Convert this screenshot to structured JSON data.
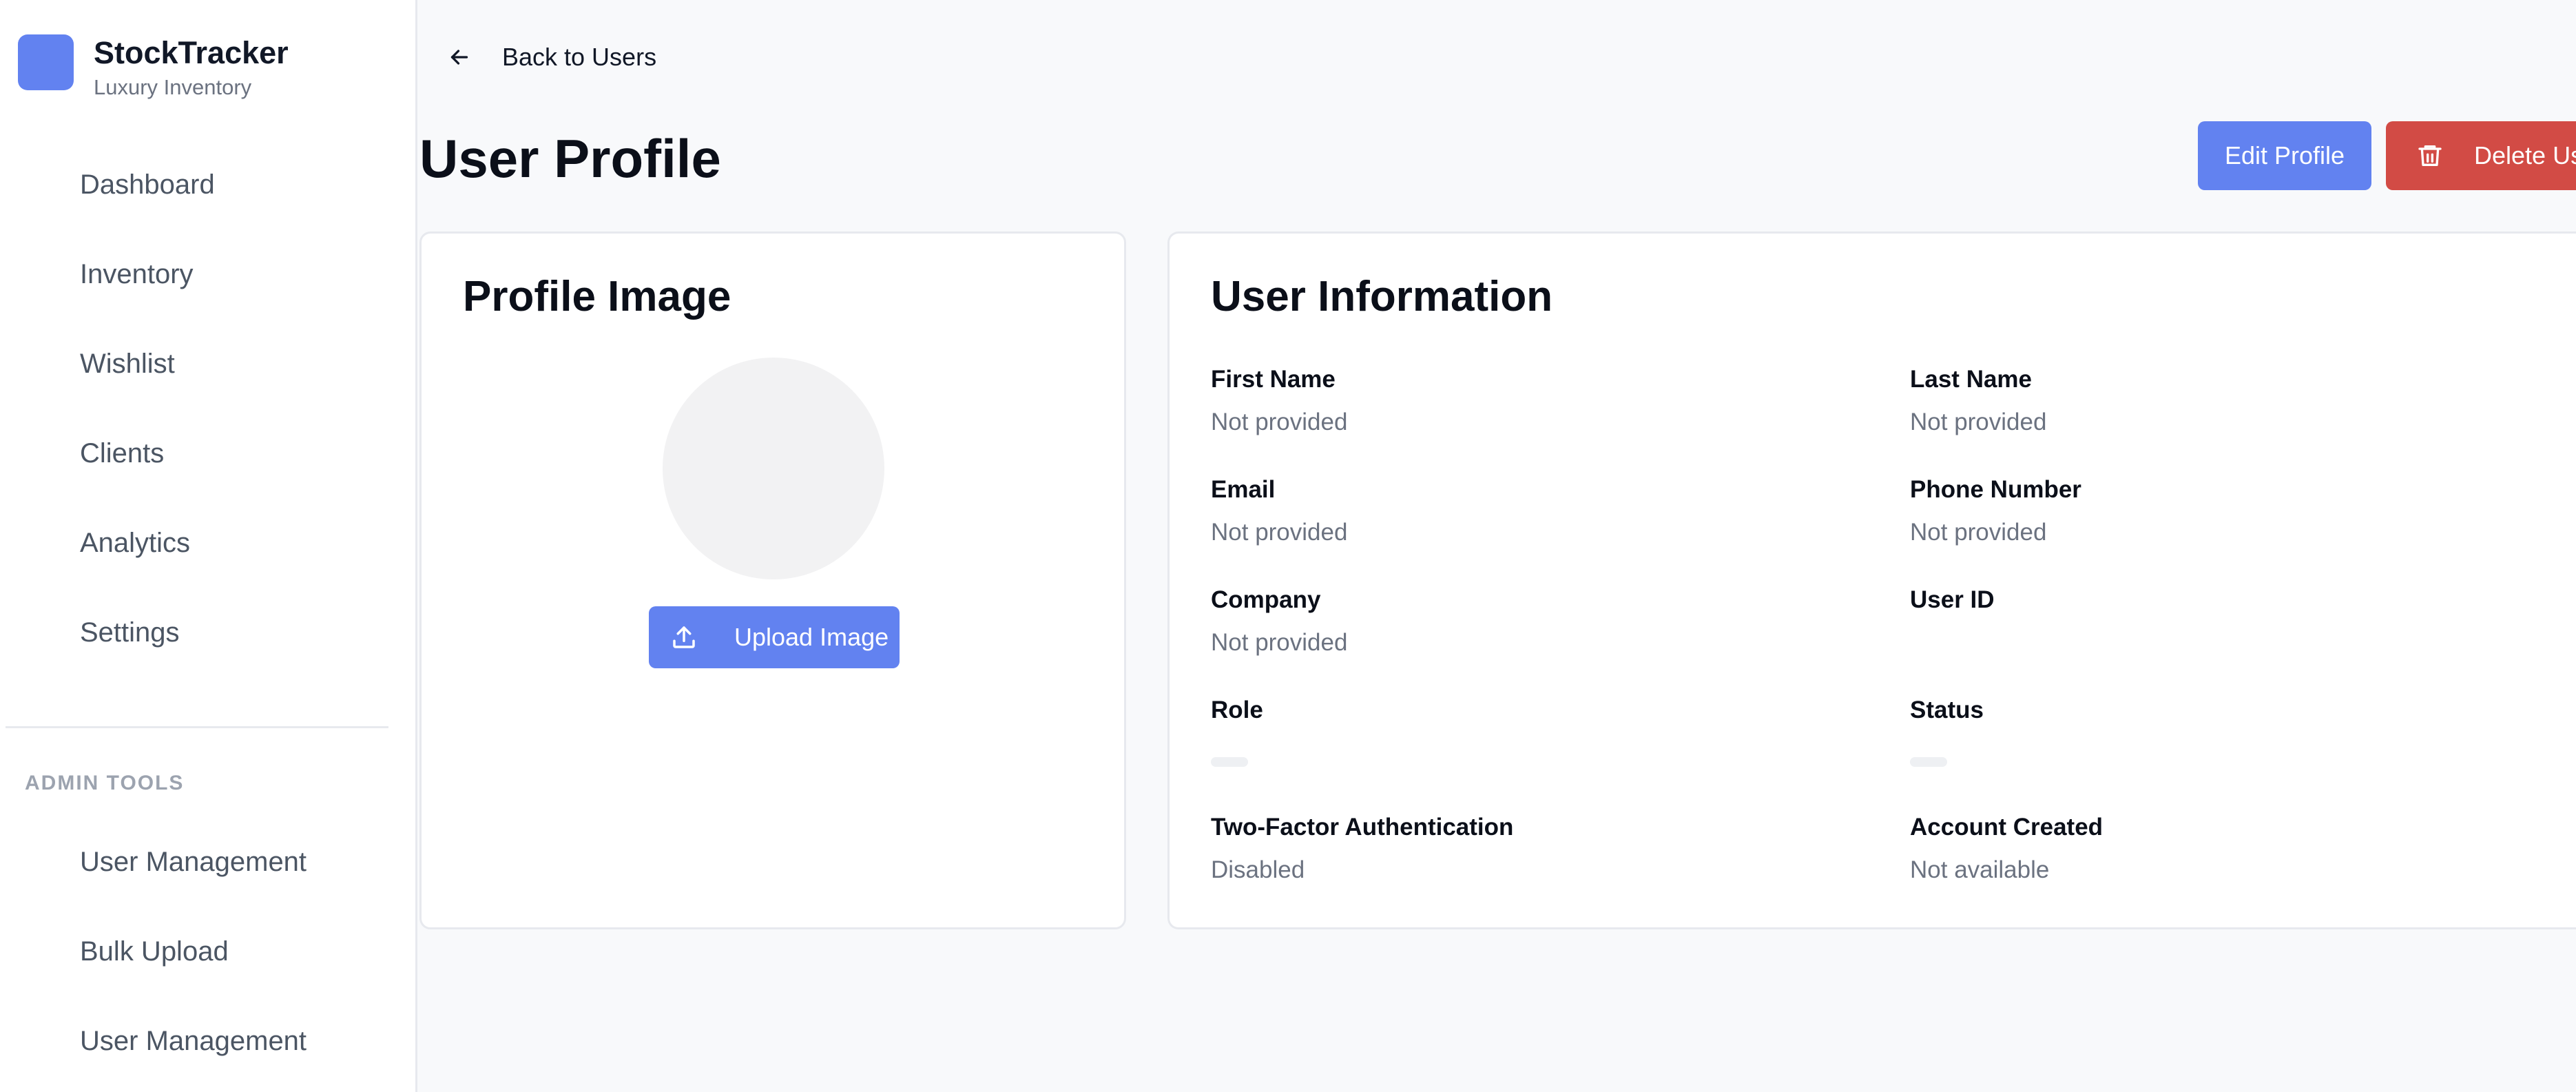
{
  "brand": {
    "name": "StockTracker",
    "subtitle": "Luxury Inventory",
    "accent": "#6282f0"
  },
  "sidebar": {
    "items": [
      {
        "label": "Dashboard"
      },
      {
        "label": "Inventory"
      },
      {
        "label": "Wishlist"
      },
      {
        "label": "Clients"
      },
      {
        "label": "Analytics"
      },
      {
        "label": "Settings"
      }
    ],
    "admin_section_label": "ADMIN TOOLS",
    "admin_items": [
      {
        "label": "User Management"
      },
      {
        "label": "Bulk Upload"
      },
      {
        "label": "User Management"
      }
    ]
  },
  "header": {
    "back_label": "Back to Users",
    "title": "User Profile",
    "edit_label": "Edit Profile",
    "delete_label": "Delete User",
    "delete_color": "#d24b45"
  },
  "profile_card": {
    "title": "Profile Image",
    "upload_label": "Upload Image"
  },
  "info_card": {
    "title": "User Information",
    "fields": [
      {
        "label": "First Name",
        "value": "Not provided"
      },
      {
        "label": "Last Name",
        "value": "Not provided"
      },
      {
        "label": "Email",
        "value": "Not provided"
      },
      {
        "label": "Phone Number",
        "value": "Not provided"
      },
      {
        "label": "Company",
        "value": "Not provided"
      },
      {
        "label": "User ID",
        "value": ""
      },
      {
        "label": "Role",
        "value": ""
      },
      {
        "label": "Status",
        "value": ""
      },
      {
        "label": "Two-Factor Authentication",
        "value": "Disabled"
      },
      {
        "label": "Account Created",
        "value": "Not available"
      }
    ]
  }
}
